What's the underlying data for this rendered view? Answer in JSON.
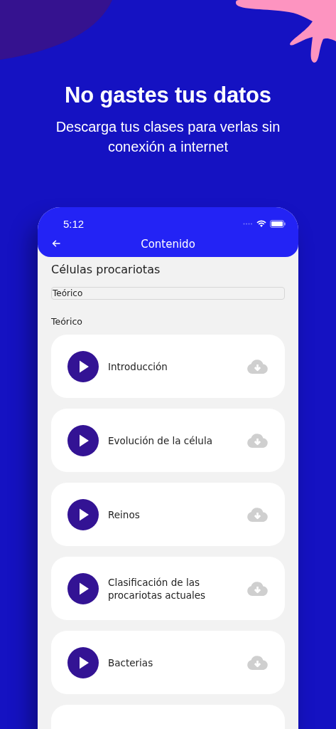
{
  "headline": "No gastes tus datos",
  "subheadline": "Descarga tus clases para verlas sin conexión a internet",
  "phone": {
    "status_bar": {
      "time": "5:12"
    },
    "header": {
      "title": "Contenido"
    },
    "course_title": "Células procariotas",
    "filter": {
      "value": "Teórico"
    },
    "section_label": "Teórico",
    "lessons": [
      {
        "title": "Introducción"
      },
      {
        "title": "Evolución de la célula"
      },
      {
        "title": "Reinos"
      },
      {
        "title": "Clasificación de las procariotas actuales"
      },
      {
        "title": "Bacterias"
      }
    ]
  }
}
